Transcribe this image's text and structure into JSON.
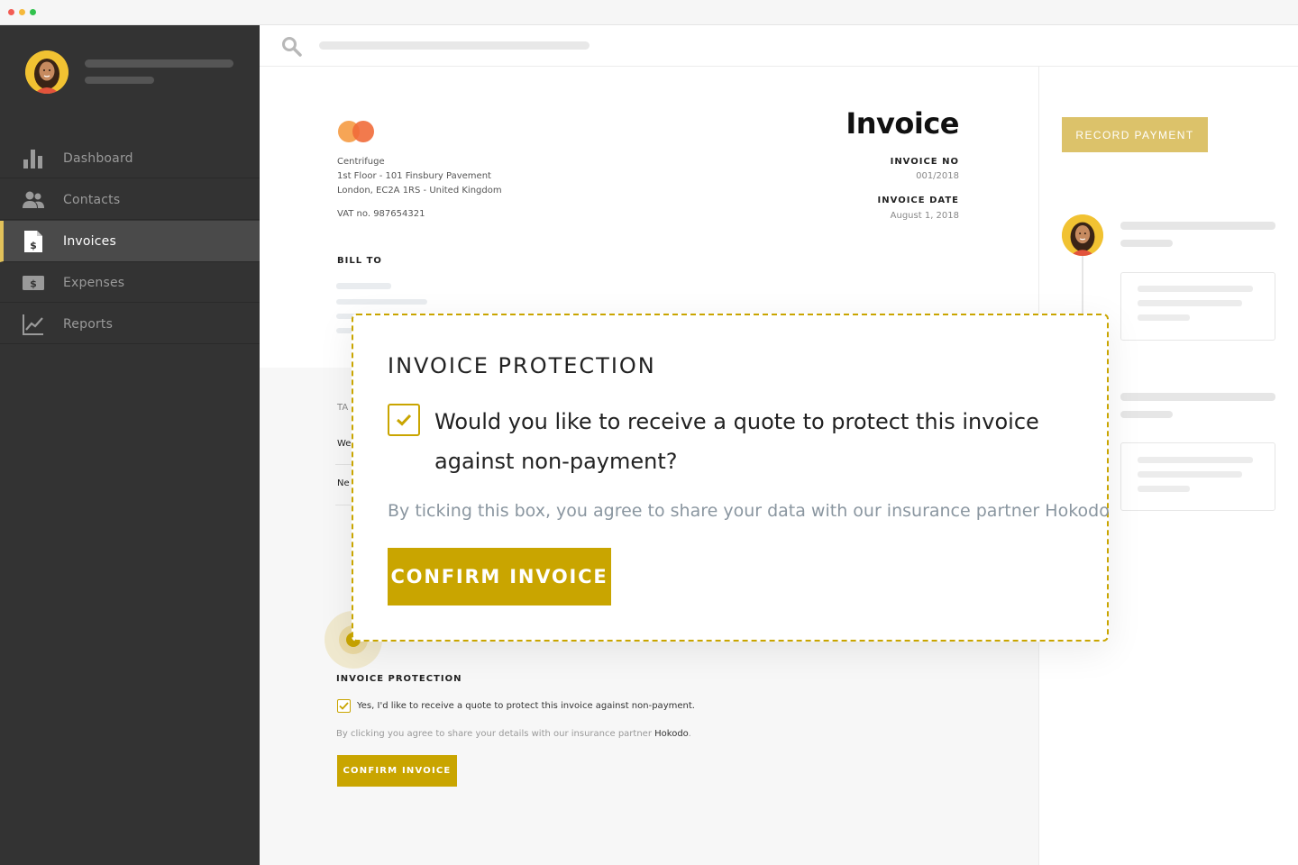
{
  "sidebar": {
    "items": [
      {
        "label": "Dashboard",
        "icon": "bar-chart-icon"
      },
      {
        "label": "Contacts",
        "icon": "people-icon"
      },
      {
        "label": "Invoices",
        "icon": "invoice-document-icon",
        "active": true
      },
      {
        "label": "Expenses",
        "icon": "cash-icon"
      },
      {
        "label": "Reports",
        "icon": "line-chart-icon"
      }
    ]
  },
  "invoice": {
    "title": "Invoice",
    "company_name": "Centrifuge",
    "address_line1": "1st Floor - 101 Finsbury Pavement",
    "address_line2": "London, EC2A 1RS - United Kingdom",
    "vat": "VAT no. 987654321",
    "invoice_no_label": "INVOICE NO",
    "invoice_no": "001/2018",
    "invoice_date_label": "INVOICE DATE",
    "invoice_date": "August 1, 2018",
    "bill_to_label": "BILL TO",
    "table_header_fragment": "TA",
    "row1_fragment": "We",
    "row2_fragment": "Ne"
  },
  "right_panel": {
    "record_payment_label": "RECORD PAYMENT"
  },
  "protection_small": {
    "heading": "INVOICE PROTECTION",
    "question": "Yes, I'd like to receive a quote to protect this invoice against non-payment.",
    "disclaimer_prefix": "By clicking you agree to share your details with our insurance partner ",
    "partner": "Hokodo",
    "disclaimer_suffix": ".",
    "confirm_label": "CONFIRM INVOICE",
    "checked": true
  },
  "protection_callout": {
    "heading": "INVOICE PROTECTION",
    "question": "Would you like to receive a quote to protect this invoice against non-payment?",
    "disclaimer": "By ticking this box, you agree to share your data with our insurance partner Hokodo",
    "confirm_label": "CONFIRM INVOICE",
    "checked": true
  },
  "colors": {
    "sidebar_bg": "#333333",
    "accent_gold": "#c9a500",
    "record_payment_bg": "#dcc26a",
    "active_indicator": "#e1c15a"
  }
}
